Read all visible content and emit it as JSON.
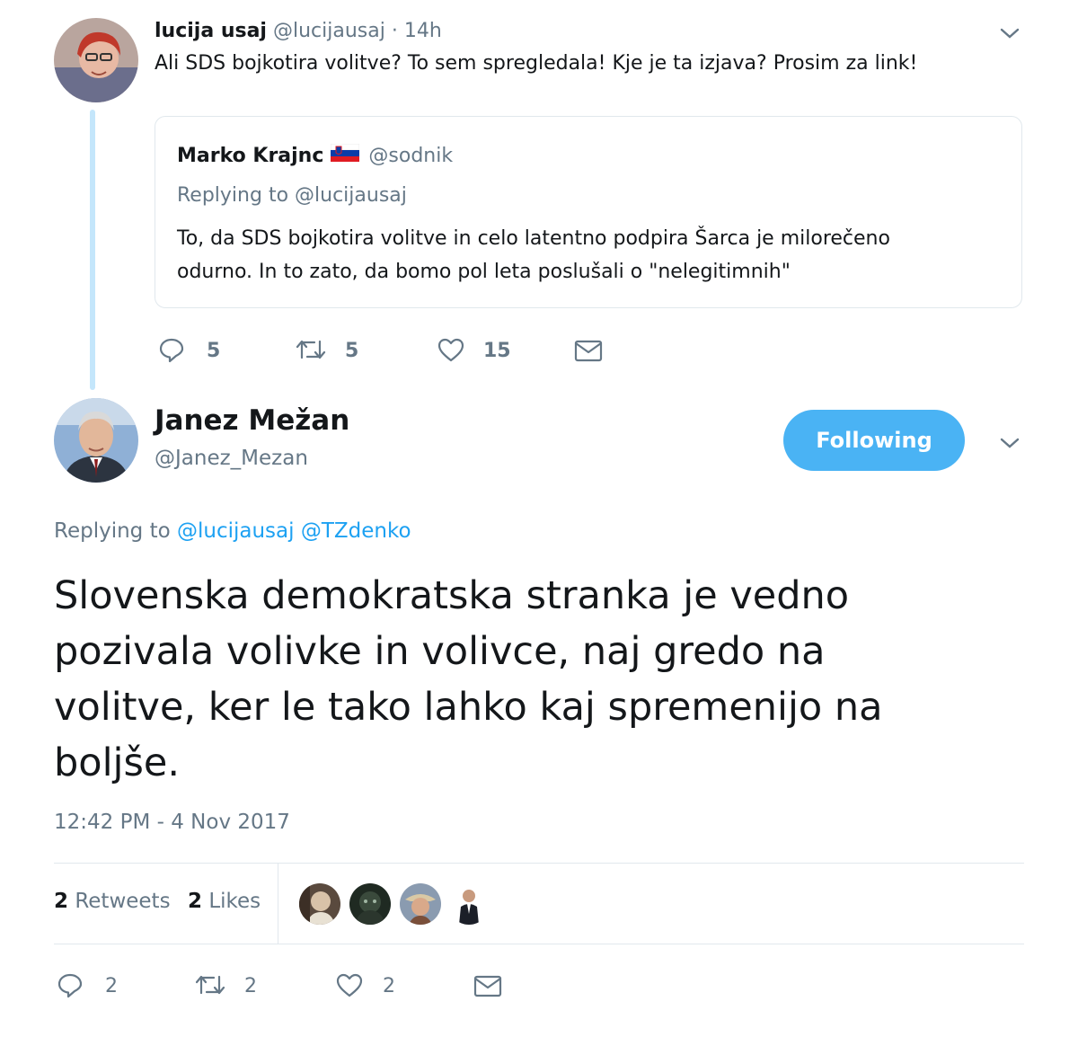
{
  "reply_tweet": {
    "display_name": "lucija usaj",
    "handle": "@lucijausaj",
    "separator": "·",
    "time": "14h",
    "text": "Ali SDS bojkotira volitve? To sem spregledala! Kje je ta izjava? Prosim za link!",
    "quoted": {
      "display_name": "Marko Krajnc",
      "flag_icon": "slovenia-flag-icon",
      "handle": "@sodnik",
      "replying_label": "Replying to",
      "replying_handle": "@lucijausaj",
      "text_line1": "To, da SDS bojkotira volitve in celo latentno podpira Šarca je milorečeno",
      "text_line2": "odurno. In to zato, da bomo pol leta poslušali o \"nelegitimnih\""
    },
    "actions": {
      "reply_count": "5",
      "retweet_count": "5",
      "like_count": "15"
    }
  },
  "main_tweet": {
    "display_name": "Janez Mežan",
    "handle": "@Janez_Mezan",
    "follow_button": "Following",
    "replying_label": "Replying to",
    "replying_handle_1": "@lucijausaj",
    "replying_handle_2": "@TZdenko",
    "text_line1": "Slovenska demokratska stranka je vedno",
    "text_line2": "pozivala volivke in volivce, naj gredo na",
    "text_line3": "volitve, ker le tako lahko kaj spremenijo na",
    "text_line4": "boljše.",
    "timestamp": "12:42 PM - 4 Nov 2017",
    "stats": {
      "retweets_count": "2",
      "retweets_label": "Retweets",
      "likes_count": "2",
      "likes_label": "Likes"
    },
    "actions": {
      "reply_count": "2",
      "retweet_count": "2",
      "like_count": "2"
    }
  },
  "colors": {
    "accent": "#1da1f2",
    "follow_bg": "#4ab3f4",
    "muted": "#657786",
    "thread_line": "#c4e6fb",
    "border": "#e1e8ed"
  }
}
